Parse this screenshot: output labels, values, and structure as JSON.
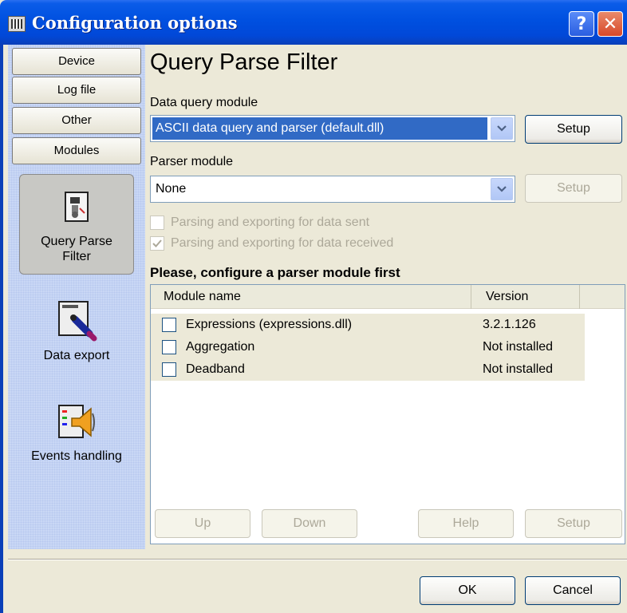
{
  "window": {
    "title": "Configuration options",
    "help_glyph": "?",
    "close_glyph": "✕"
  },
  "left_tabs": [
    {
      "label": "Device"
    },
    {
      "label": "Log file"
    },
    {
      "label": "Other"
    },
    {
      "label": "Modules"
    }
  ],
  "modules": [
    {
      "label_lines": [
        "Query Parse",
        "Filter"
      ],
      "icon": "filter-module-icon",
      "selected": true
    },
    {
      "label_lines": [
        "Data export"
      ],
      "icon": "data-export-icon",
      "selected": false
    },
    {
      "label_lines": [
        "Events handling"
      ],
      "icon": "speaker-icon",
      "selected": false
    }
  ],
  "main": {
    "heading": "Query Parse Filter",
    "data_query": {
      "label": "Data query module",
      "value": "ASCII data query and parser (default.dll)",
      "setup_label": "Setup"
    },
    "parser": {
      "label": "Parser module",
      "value": "None",
      "setup_label": "Setup"
    },
    "options": {
      "sent_label": "Parsing and exporting for data sent",
      "sent_checked": false,
      "received_label": "Parsing and exporting for data received",
      "received_checked": true
    },
    "subheading": "Please, configure a parser module first",
    "table": {
      "columns": [
        "Module name",
        "Version"
      ],
      "rows": [
        {
          "name": "Expressions (expressions.dll)",
          "version": "3.2.1.126"
        },
        {
          "name": "Aggregation",
          "version": "Not installed"
        },
        {
          "name": "Deadband",
          "version": "Not installed"
        }
      ]
    },
    "buttons": {
      "up": "Up",
      "down": "Down",
      "help": "Help",
      "setup": "Setup"
    }
  },
  "footer": {
    "ok": "OK",
    "cancel": "Cancel"
  },
  "colors": {
    "title_bar": "#0050e0",
    "selection": "#316ac5",
    "left_panel": "#c9d7f5"
  }
}
